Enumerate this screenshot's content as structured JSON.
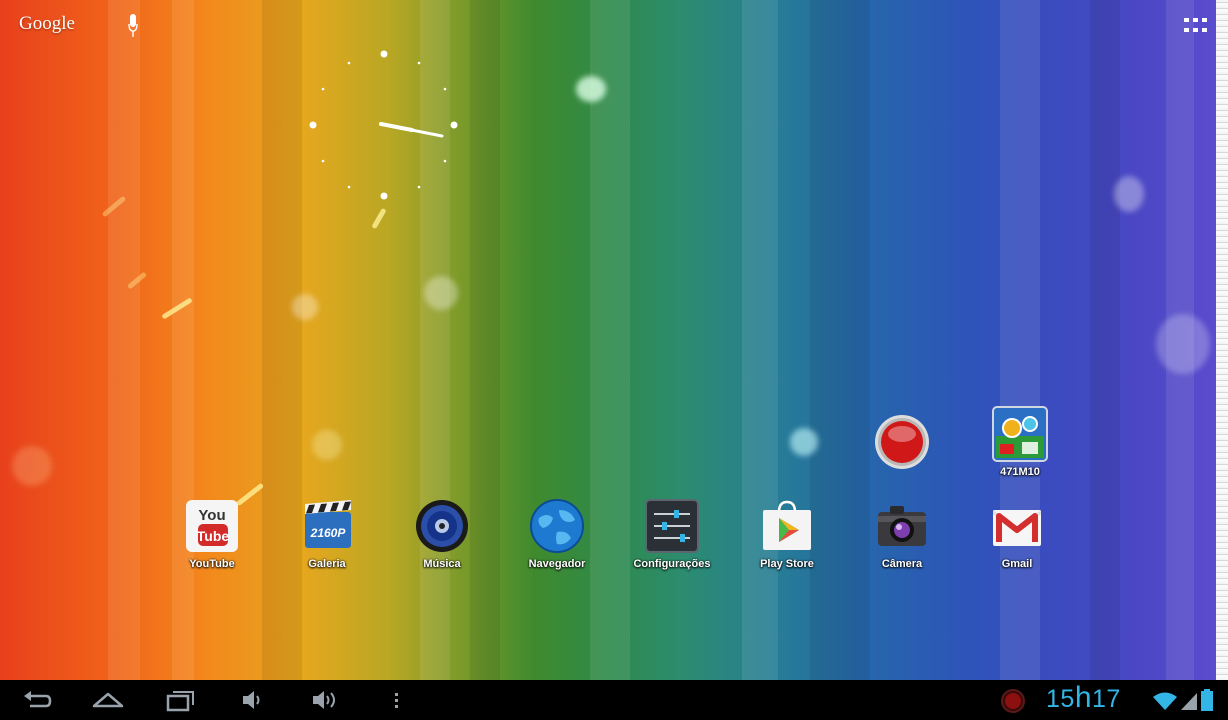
{
  "top_bar": {
    "search_logo": "Google",
    "mic_icon": "mic-icon",
    "all_apps_icon": "apps-grid-icon"
  },
  "widget": {
    "type": "analog-clock"
  },
  "apps_top": [
    {
      "label": "",
      "icon": "record-icon"
    },
    {
      "label": "471M10",
      "icon": "screenshot-app-icon"
    }
  ],
  "dock_apps": [
    {
      "label": "YouTube",
      "icon": "youtube-icon"
    },
    {
      "label": "Galeria",
      "icon": "gallery-icon"
    },
    {
      "label": "Música",
      "icon": "music-icon"
    },
    {
      "label": "Navegador",
      "icon": "browser-icon"
    },
    {
      "label": "Configurações",
      "icon": "settings-icon"
    },
    {
      "label": "Play Store",
      "icon": "play-store-icon"
    },
    {
      "label": "Câmera",
      "icon": "camera-icon"
    },
    {
      "label": "Gmail",
      "icon": "gmail-icon"
    }
  ],
  "gallery_badge": "2160P",
  "youtube_badge": {
    "you": "You",
    "tube": "Tube"
  },
  "navbar": {
    "buttons": [
      "back-icon",
      "home-icon",
      "recent-apps-icon",
      "volume-down-icon",
      "volume-up-icon",
      "menu-icon"
    ]
  },
  "status": {
    "hours": "15",
    "h_sep": "h",
    "minutes": "17",
    "icons": [
      "recording-indicator-icon",
      "wifi-icon",
      "signal-icon",
      "battery-icon"
    ]
  },
  "colors": {
    "status_accent": "#33b5e5",
    "record_red": "#d01818"
  }
}
